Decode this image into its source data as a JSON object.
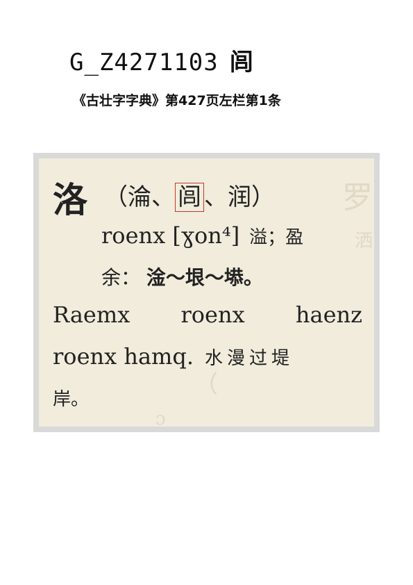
{
  "header": {
    "code": "G_Z4271103",
    "glyph": "闾"
  },
  "source": {
    "text": "《古壮字字典》第427页左栏第1条"
  },
  "entry": {
    "headword": "洛",
    "variants_open": "（",
    "variant1": "淪",
    "separator1": "、",
    "variant_highlighted": "闾",
    "separator2": "、",
    "variant3": "润",
    "variants_close": "）",
    "pronunciation": "roenx [ɣon⁴]",
    "definition_part1": "溢；盈",
    "definition_part2": "余：",
    "example_cjk": "淦～垠～塨。",
    "example_zh_words": [
      "Raemx",
      "roenx",
      "haenz"
    ],
    "example_zh_end": "roenx hamq.",
    "translation": "水漫过堤",
    "translation_end": "岸。"
  }
}
